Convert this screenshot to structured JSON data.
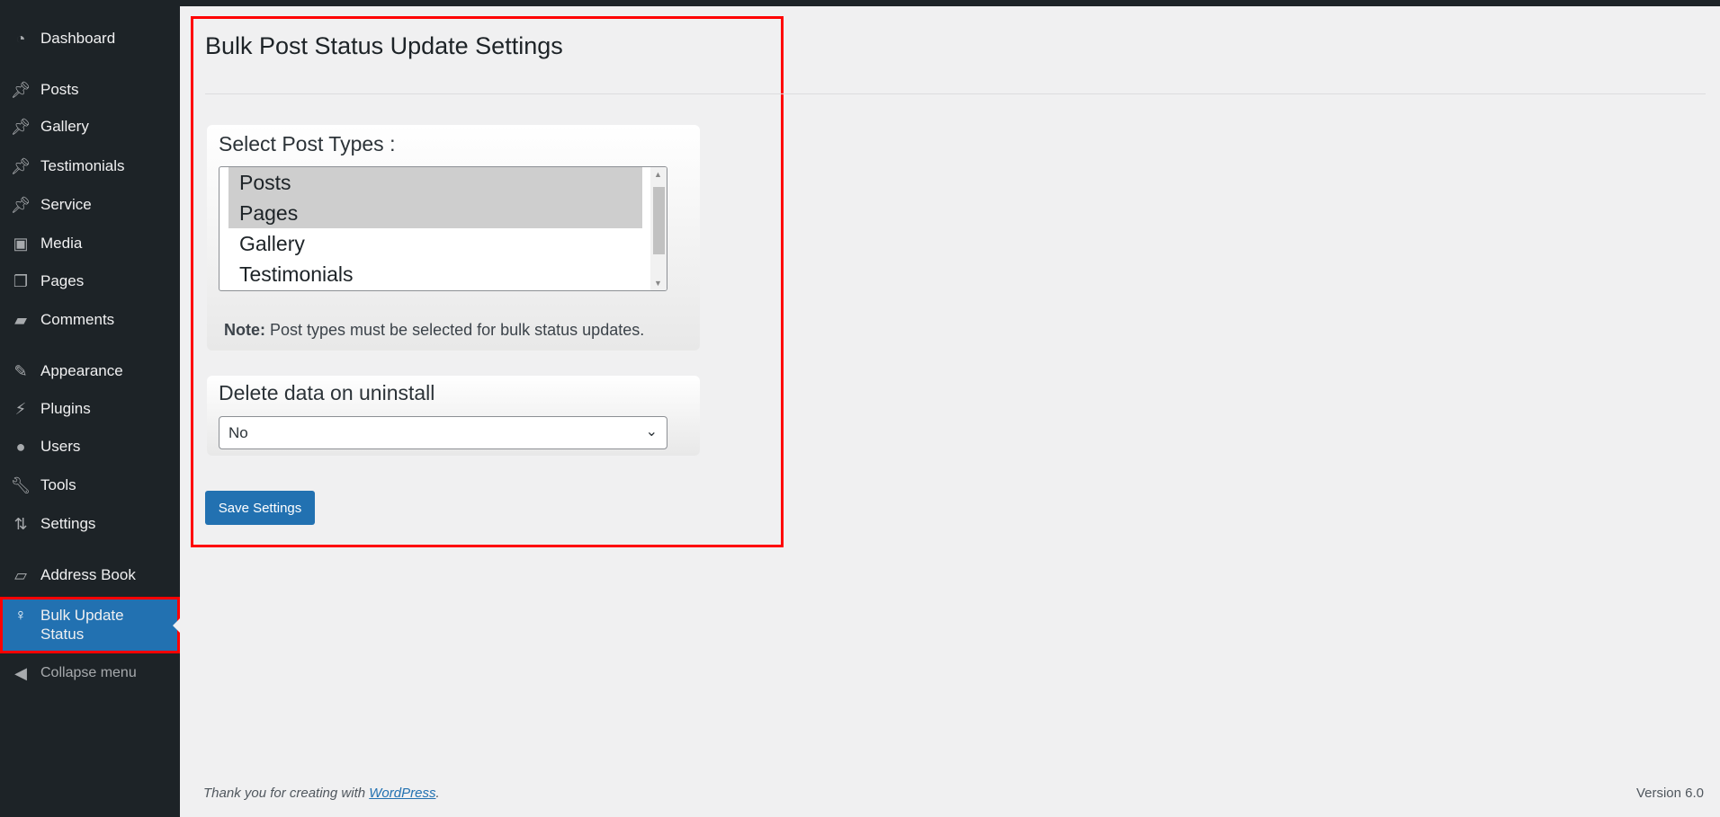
{
  "sidebar": {
    "items": [
      {
        "label": "Dashboard",
        "icon": "dashboard-icon"
      },
      {
        "label": "Posts",
        "icon": "pin-icon"
      },
      {
        "label": "Gallery",
        "icon": "pin-icon"
      },
      {
        "label": "Testimonials",
        "icon": "pin-icon"
      },
      {
        "label": "Service",
        "icon": "pin-icon"
      },
      {
        "label": "Media",
        "icon": "media-icon"
      },
      {
        "label": "Pages",
        "icon": "pages-icon"
      },
      {
        "label": "Comments",
        "icon": "comment-icon"
      },
      {
        "label": "Appearance",
        "icon": "paintbrush-icon"
      },
      {
        "label": "Plugins",
        "icon": "plugin-icon"
      },
      {
        "label": "Users",
        "icon": "user-icon"
      },
      {
        "label": "Tools",
        "icon": "wrench-icon"
      },
      {
        "label": "Settings",
        "icon": "settings-icon"
      },
      {
        "label": "Address Book",
        "icon": "map-icon"
      },
      {
        "label": "Bulk Update Status",
        "icon": "key-icon",
        "active": true
      },
      {
        "label": "Collapse menu",
        "icon": "collapse-icon"
      }
    ],
    "active_color": "#2271b1"
  },
  "main": {
    "title": "Bulk Post Status Update Settings",
    "post_types": {
      "label": "Select Post Types :",
      "options": [
        "Posts",
        "Pages",
        "Gallery",
        "Testimonials"
      ],
      "selected": [
        "Posts",
        "Pages"
      ],
      "note_bold": "Note:",
      "note": " Post types must be selected for bulk status updates."
    },
    "delete_data": {
      "label": "Delete data on uninstall",
      "value": "No"
    },
    "save_label": "Save Settings"
  },
  "footer": {
    "thanks": "Thank you for creating with ",
    "link": "WordPress",
    "period": ".",
    "version": "Version 6.0"
  }
}
